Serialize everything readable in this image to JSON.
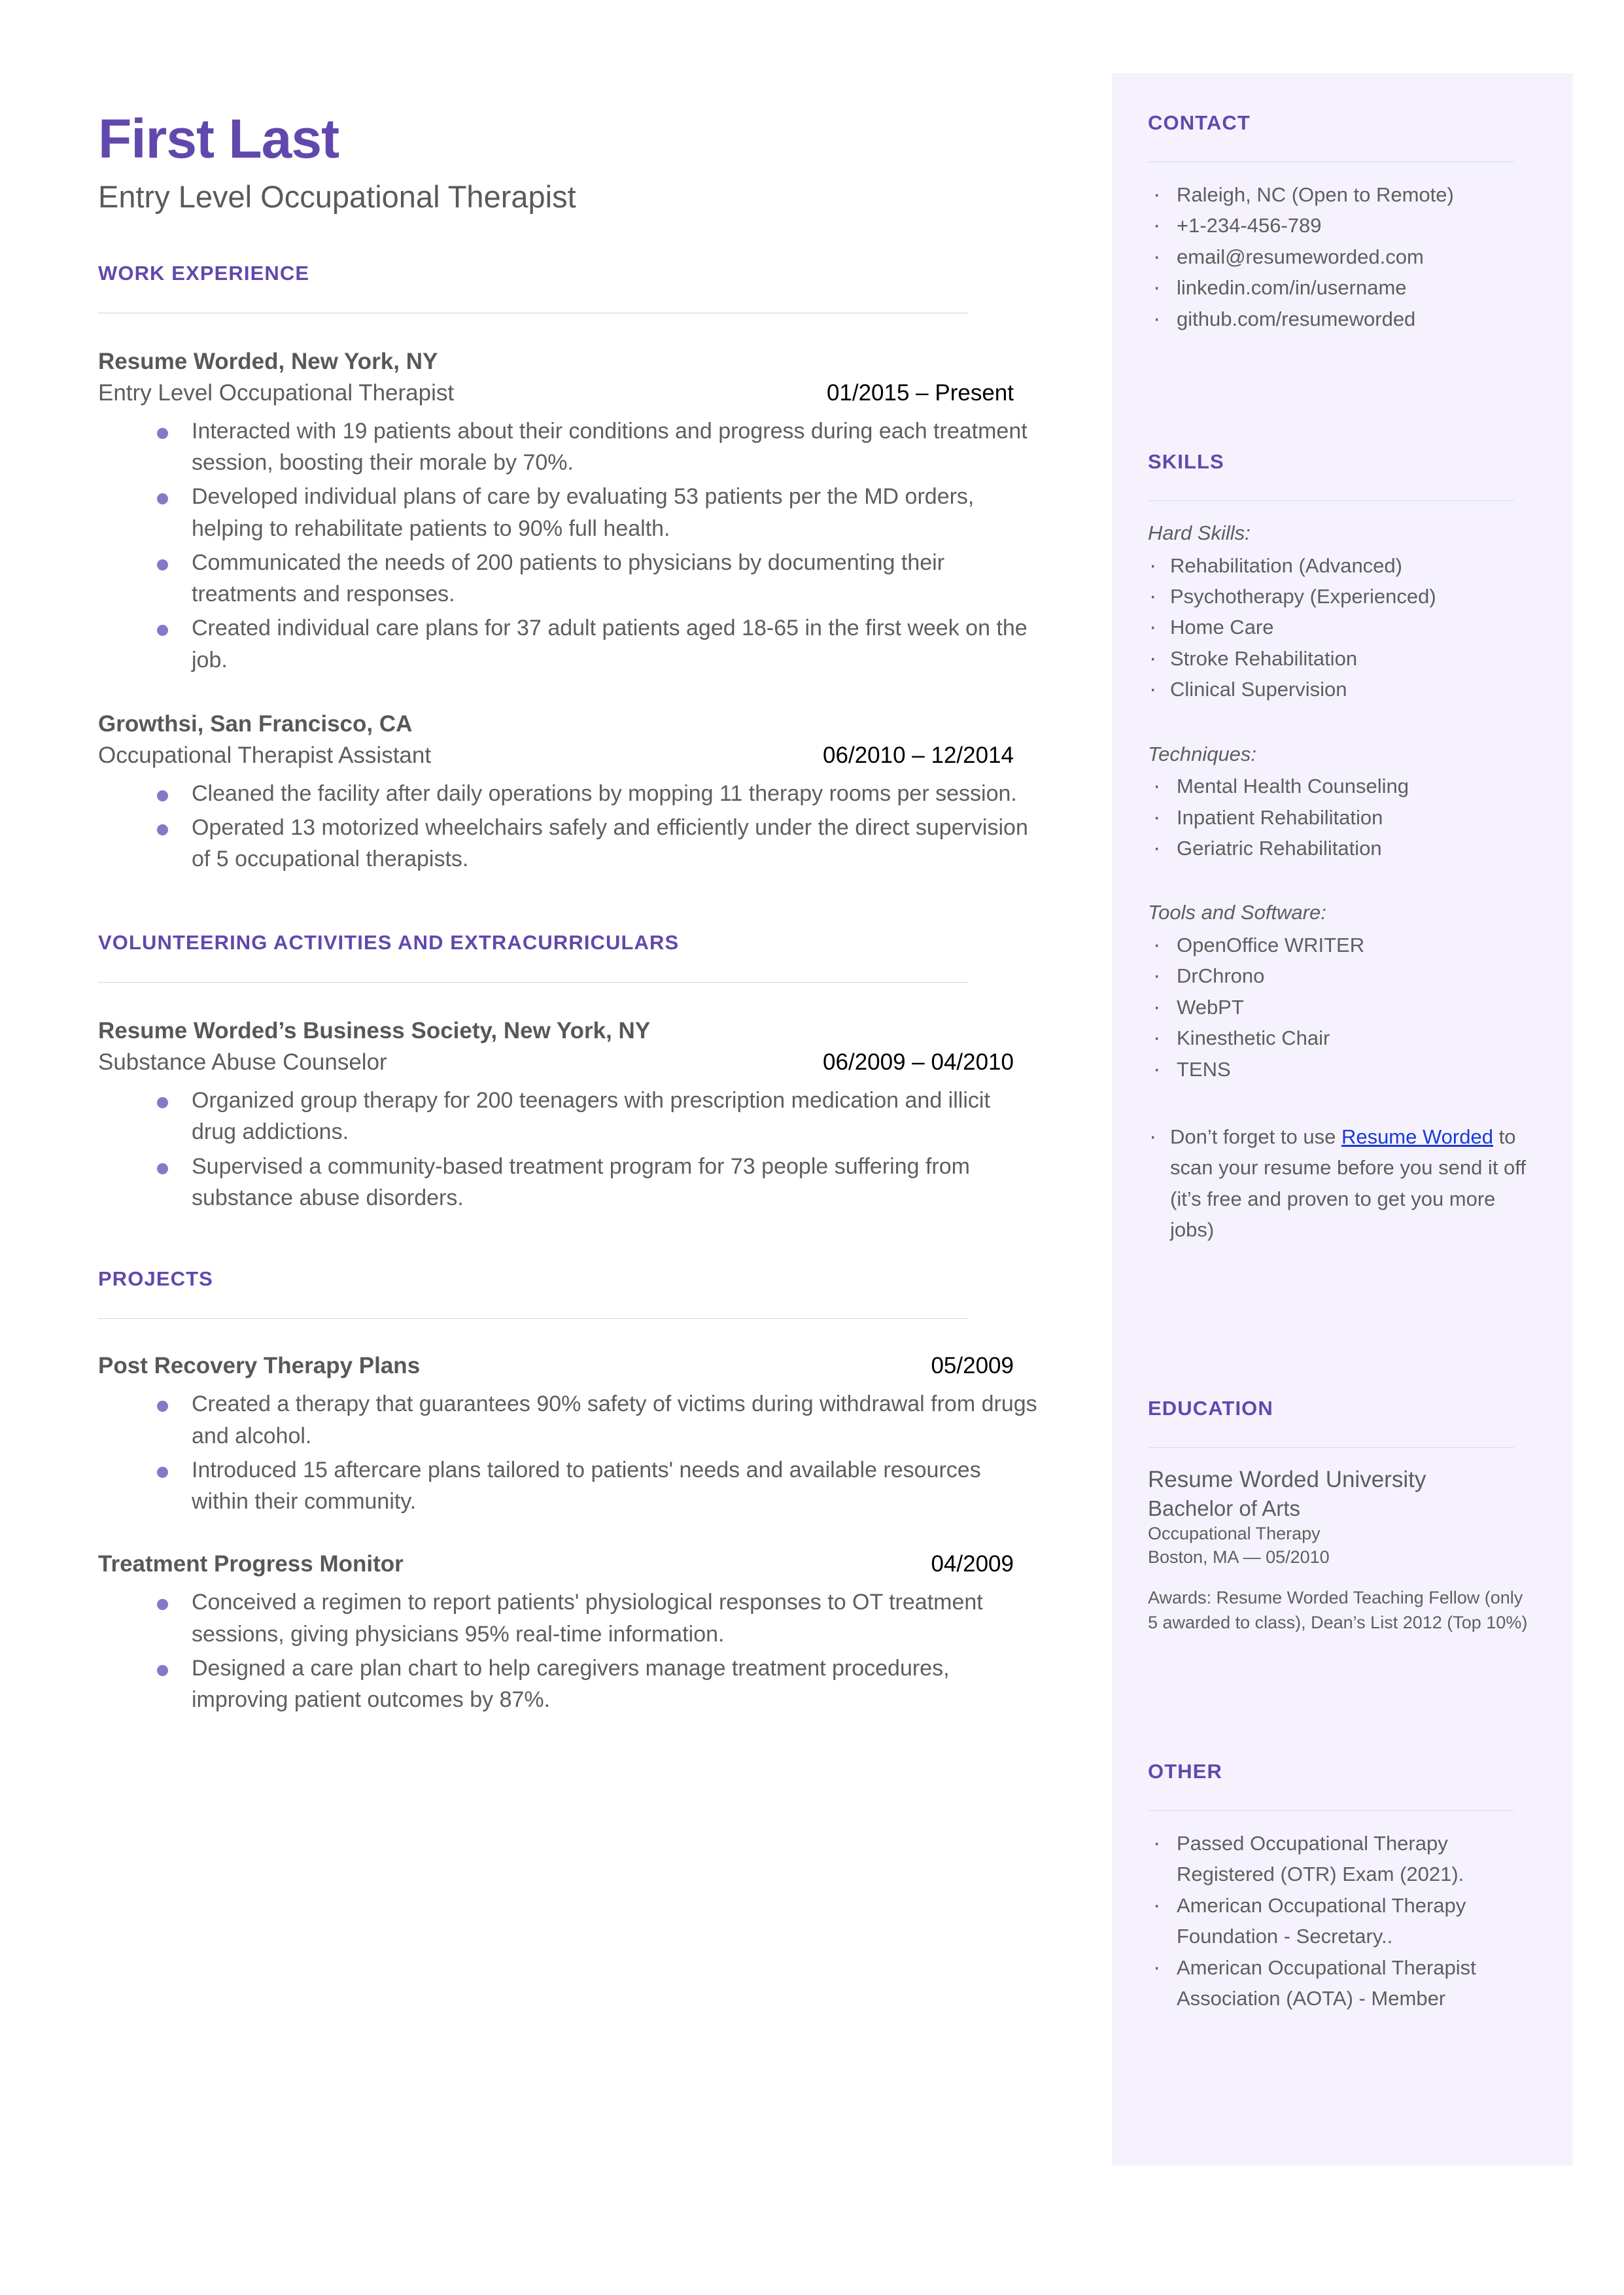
{
  "colors": {
    "accent_purple": "#6248ad",
    "bullet_purple": "#8a76c8",
    "sidebar_bg": "#f5f2fe",
    "body_text": "#5e5e5e",
    "link_blue": "#1a3ad6"
  },
  "header": {
    "name": "First Last",
    "headline": "Entry Level Occupational Therapist"
  },
  "main": {
    "sections": [
      {
        "heading": "WORK EXPERIENCE",
        "entries": [
          {
            "organization": "Resume Worded, New York, NY",
            "role": "Entry Level Occupational Therapist",
            "date": "01/2015 – Present",
            "bullets": [
              "Interacted with 19 patients about their conditions and progress during each treatment session, boosting their morale by 70%.",
              "Developed individual plans of care by evaluating 53 patients per the MD orders, helping to rehabilitate patients to 90% full health.",
              "Communicated the needs of 200 patients to physicians by documenting their treatments and responses.",
              "Created individual care plans for 37 adult patients aged 18-65 in the first week on the job."
            ]
          },
          {
            "organization": "Growthsi, San Francisco, CA",
            "role": "Occupational Therapist Assistant",
            "date": "06/2010 – 12/2014",
            "bullets": [
              "Cleaned the facility after daily operations by mopping 11 therapy rooms per session.",
              "Operated 13 motorized wheelchairs safely and efficiently under the direct supervision of 5 occupational therapists."
            ]
          }
        ]
      },
      {
        "heading": "VOLUNTEERING ACTIVITIES AND EXTRACURRICULARS",
        "entries": [
          {
            "organization": "Resume Worded’s Business Society, New York, NY",
            "role": "Substance Abuse Counselor",
            "date": "06/2009 – 04/2010",
            "bullets": [
              "Organized group therapy for 200 teenagers with prescription medication and illicit drug addictions.",
              "Supervised a community-based treatment program for 73 people suffering from substance abuse disorders."
            ]
          }
        ]
      },
      {
        "heading": "PROJECTS",
        "projects": [
          {
            "title": "Post Recovery Therapy Plans",
            "date": "05/2009",
            "bullets": [
              "Created a therapy that guarantees 90% safety of victims during withdrawal from drugs and alcohol.",
              "Introduced 15 aftercare plans tailored to patients' needs and available resources within their community."
            ]
          },
          {
            "title": "Treatment Progress Monitor",
            "date": "04/2009",
            "bullets": [
              "Conceived a regimen to report patients' physiological responses to OT treatment sessions, giving physicians 95% real-time information.",
              "Designed a care plan chart to help caregivers manage treatment procedures, improving patient outcomes by 87%."
            ]
          }
        ]
      }
    ]
  },
  "sidebar": {
    "contact": {
      "heading": "CONTACT",
      "items": [
        "Raleigh, NC (Open to Remote)",
        "+1-234-456-789",
        "email@resumeworded.com",
        "linkedin.com/in/username",
        "github.com/resumeworded"
      ]
    },
    "skills": {
      "heading": "SKILLS",
      "groups": [
        {
          "label": "Hard Skills:",
          "items": [
            "Rehabilitation (Advanced)",
            "Psychotherapy (Experienced)",
            "Home Care",
            "Stroke Rehabilitation",
            "Clinical Supervision"
          ]
        },
        {
          "label": "Techniques:",
          "items": [
            "Mental Health Counseling",
            "Inpatient Rehabilitation",
            "Geriatric Rehabilitation"
          ]
        },
        {
          "label": "Tools and Software:",
          "items": [
            "OpenOffice WRITER",
            "DrChrono",
            "WebPT",
            "Kinesthetic Chair",
            "TENS"
          ]
        }
      ],
      "note": {
        "before": "Don’t forget to use ",
        "link": "Resume Worded",
        "after": " to scan your resume before you send it off (it’s free and proven to get you more jobs)"
      }
    },
    "education": {
      "heading": "EDUCATION",
      "school": "Resume Worded University",
      "degree": "Bachelor of Arts",
      "field": "Occupational Therapy",
      "location_date": "Boston, MA — 05/2010",
      "awards": "Awards: Resume Worded Teaching Fellow (only 5 awarded to class), Dean’s List 2012 (Top 10%)"
    },
    "other": {
      "heading": "OTHER",
      "items": [
        "Passed Occupational Therapy Registered (OTR) Exam (2021).",
        "American Occupational Therapy Foundation - Secretary..",
        "American Occupational Therapist Association (AOTA) - Member"
      ]
    }
  }
}
